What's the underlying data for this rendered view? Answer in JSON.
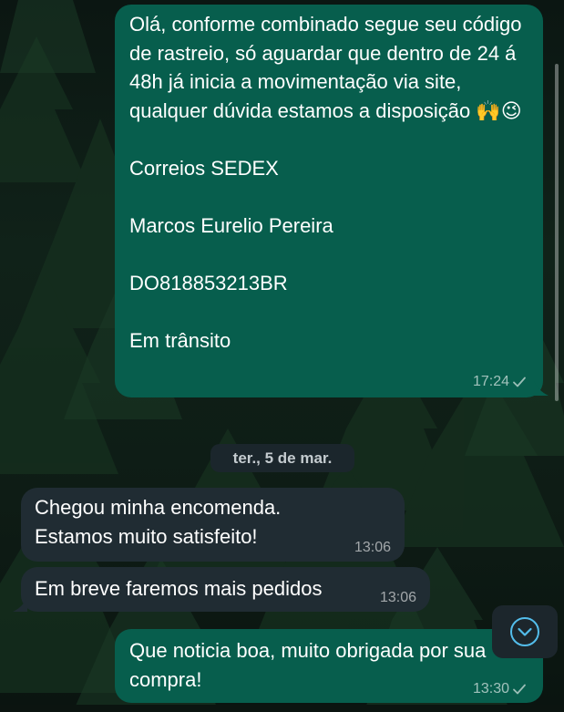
{
  "messages": [
    {
      "direction": "out",
      "text": "Olá, conforme combinado segue seu código de rastreio, só aguardar que dentro de 24 á 48h já inicia a movimentação via site, qualquer dúvida estamos a disposição 🙌😉\n\nCorreios SEDEX\n\nMarcos Eurelio Pereira\n\nDO818853213BR\n\nEm trânsito",
      "time": "17:24"
    },
    {
      "direction": "in",
      "text": "Chegou minha encomenda.\nEstamos muito satisfeito!",
      "time": "13:06"
    },
    {
      "direction": "in",
      "text": "Em breve faremos mais pedidos",
      "time": "13:06"
    },
    {
      "direction": "out",
      "text": "Que noticia boa, muito obrigada por sua\ncompra!",
      "time": "13:30"
    }
  ],
  "date_separator": "ter., 5 de mar.",
  "icons": {
    "read_receipt": "check-icon",
    "scroll_down": "chevron-down-circle-icon"
  },
  "colors": {
    "outgoing_bubble": "#075e4d",
    "incoming_bubble": "#202c33",
    "accent": "#53bdeb"
  }
}
